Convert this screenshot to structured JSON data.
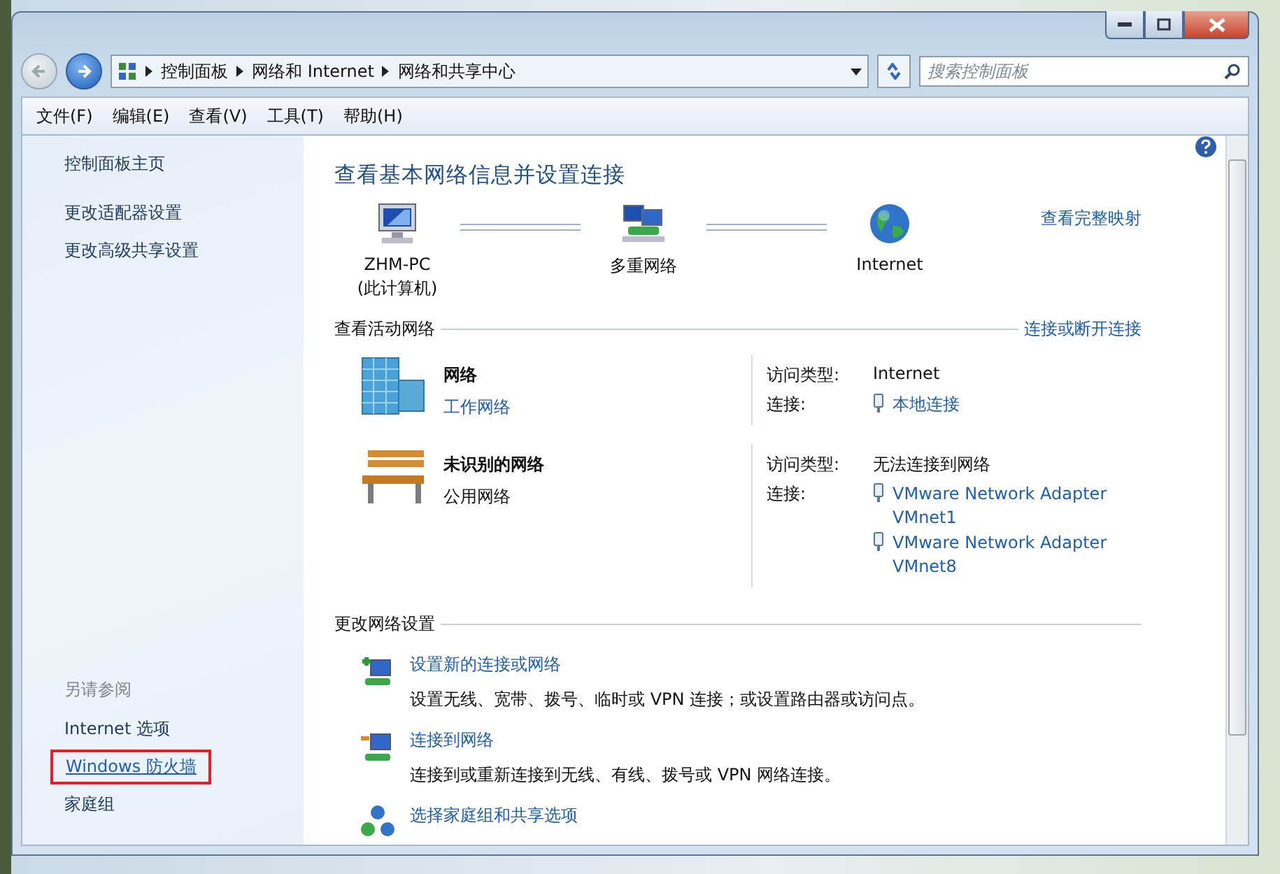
{
  "address_bar": {
    "breadcrumbs": [
      "控制面板",
      "网络和 Internet",
      "网络和共享中心"
    ]
  },
  "search": {
    "placeholder": "搜索控制面板"
  },
  "menu": [
    "文件(F)",
    "编辑(E)",
    "查看(V)",
    "工具(T)",
    "帮助(H)"
  ],
  "sidebar": {
    "items": [
      "控制面板主页",
      "更改适配器设置",
      "更改高级共享设置"
    ],
    "see_also_title": "另请参阅",
    "see_also": [
      {
        "label": "Internet 选项",
        "highlighted": false
      },
      {
        "label": "Windows 防火墙",
        "highlighted": true
      },
      {
        "label": "家庭组",
        "highlighted": false
      }
    ]
  },
  "main": {
    "title": "查看基本网络信息并设置连接",
    "full_map_link": "查看完整映射",
    "map_nodes": [
      {
        "kind": "computer",
        "label": "ZHM-PC",
        "sublabel": "(此计算机)"
      },
      {
        "kind": "network",
        "label": "多重网络"
      },
      {
        "kind": "internet",
        "label": "Internet"
      }
    ],
    "active_heading": "查看活动网络",
    "connect_link": "连接或断开连接",
    "networks": [
      {
        "kind": "building",
        "name": "网络",
        "type": "工作网络",
        "type_is_link": true,
        "access_label": "访问类型:",
        "access": "Internet",
        "connection_label": "连接:",
        "connections": [
          {
            "lines": [
              "本地连接"
            ]
          }
        ]
      },
      {
        "kind": "bench",
        "name": "未识别的网络",
        "type": "公用网络",
        "type_is_link": false,
        "access_label": "访问类型:",
        "access": "无法连接到网络",
        "connection_label": "连接:",
        "connections": [
          {
            "lines": [
              "VMware Network Adapter",
              "VMnet1"
            ]
          },
          {
            "lines": [
              "VMware Network Adapter",
              "VMnet8"
            ]
          }
        ]
      }
    ],
    "change_heading": "更改网络设置",
    "tasks": [
      {
        "kind": "new-connection",
        "title": "设置新的连接或网络",
        "description": "设置无线、宽带、拨号、临时或 VPN 连接；或设置路由器或访问点。"
      },
      {
        "kind": "connect",
        "title": "连接到网络",
        "description": "连接到或重新连接到无线、有线、拨号或 VPN 网络连接。"
      },
      {
        "kind": "homegroup",
        "title": "选择家庭组和共享选项"
      }
    ]
  }
}
